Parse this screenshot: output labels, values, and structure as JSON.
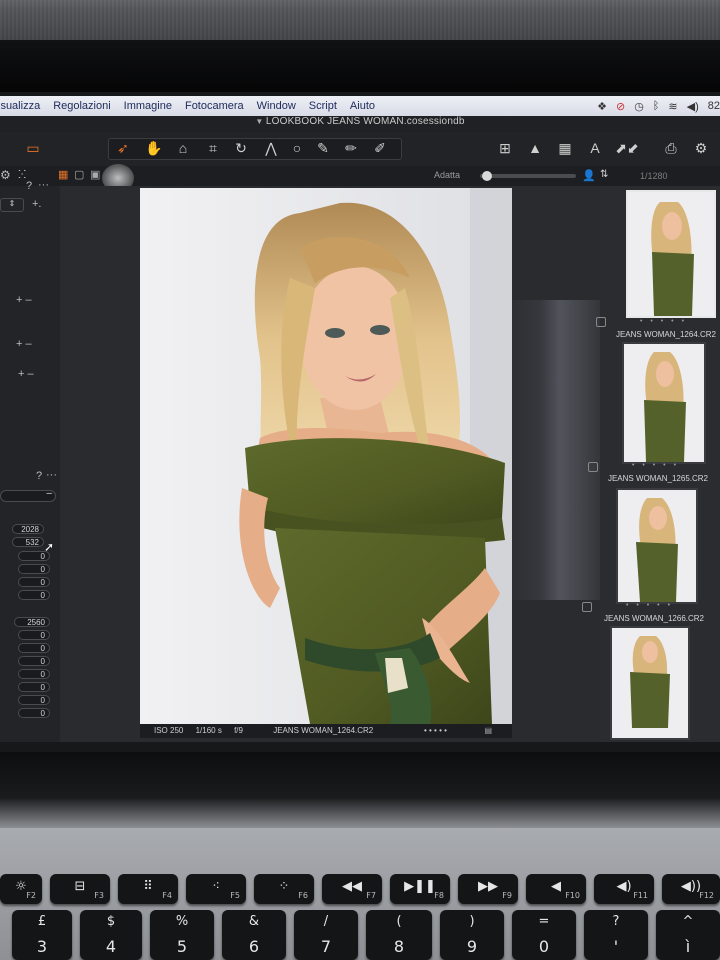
{
  "menu": {
    "items": [
      "isualizza",
      "Regolazioni",
      "Immagine",
      "Fotocamera",
      "Window",
      "Script",
      "Aiuto"
    ],
    "status_battery": "82"
  },
  "document": {
    "title": "LOOKBOOK JEANS WOMAN.cosessiondb"
  },
  "viewer": {
    "zoom_label": "Adatta",
    "image_counter": "1/1280",
    "info": {
      "iso": "ISO 250",
      "shutter": "1/160 s",
      "aperture": "f/9",
      "filename": "JEANS WOMAN_1264.CR2"
    }
  },
  "left_panel": {
    "question_marks": [
      "?",
      "?"
    ],
    "crop_values": [
      "2028",
      "532",
      "0",
      "0",
      "0",
      "0"
    ],
    "size_values": [
      "2560",
      "0",
      "0",
      "0",
      "0",
      "0",
      "0",
      "0"
    ]
  },
  "browser": {
    "thumbnails": [
      {
        "label": "JEANS WOMAN_1264.CR2",
        "selected": true
      },
      {
        "label": "JEANS WOMAN_1265.CR2",
        "selected": false
      },
      {
        "label": "JEANS WOMAN_1266.CR2",
        "selected": false
      },
      {
        "label": "",
        "selected": false
      }
    ],
    "rating_dots": "• • • • •"
  },
  "keyboard": {
    "fn_row": [
      "F2",
      "F3",
      "F4",
      "F5",
      "F6",
      "F7",
      "F8",
      "F9",
      "F10",
      "F11",
      "F12"
    ],
    "num_row": [
      {
        "hi": "£",
        "lo": "3"
      },
      {
        "hi": "$",
        "lo": "4"
      },
      {
        "hi": "%",
        "lo": "5"
      },
      {
        "hi": "&",
        "lo": "6"
      },
      {
        "hi": "/",
        "lo": "7"
      },
      {
        "hi": "(",
        "lo": "8"
      },
      {
        "hi": ")",
        "lo": "9"
      },
      {
        "hi": "=",
        "lo": "0"
      },
      {
        "hi": "?",
        "lo": "'"
      },
      {
        "hi": "^",
        "lo": "ì"
      }
    ]
  },
  "colors": {
    "accent": "#e8742a",
    "menubar": "#e6e9f2",
    "panel": "#232427"
  }
}
